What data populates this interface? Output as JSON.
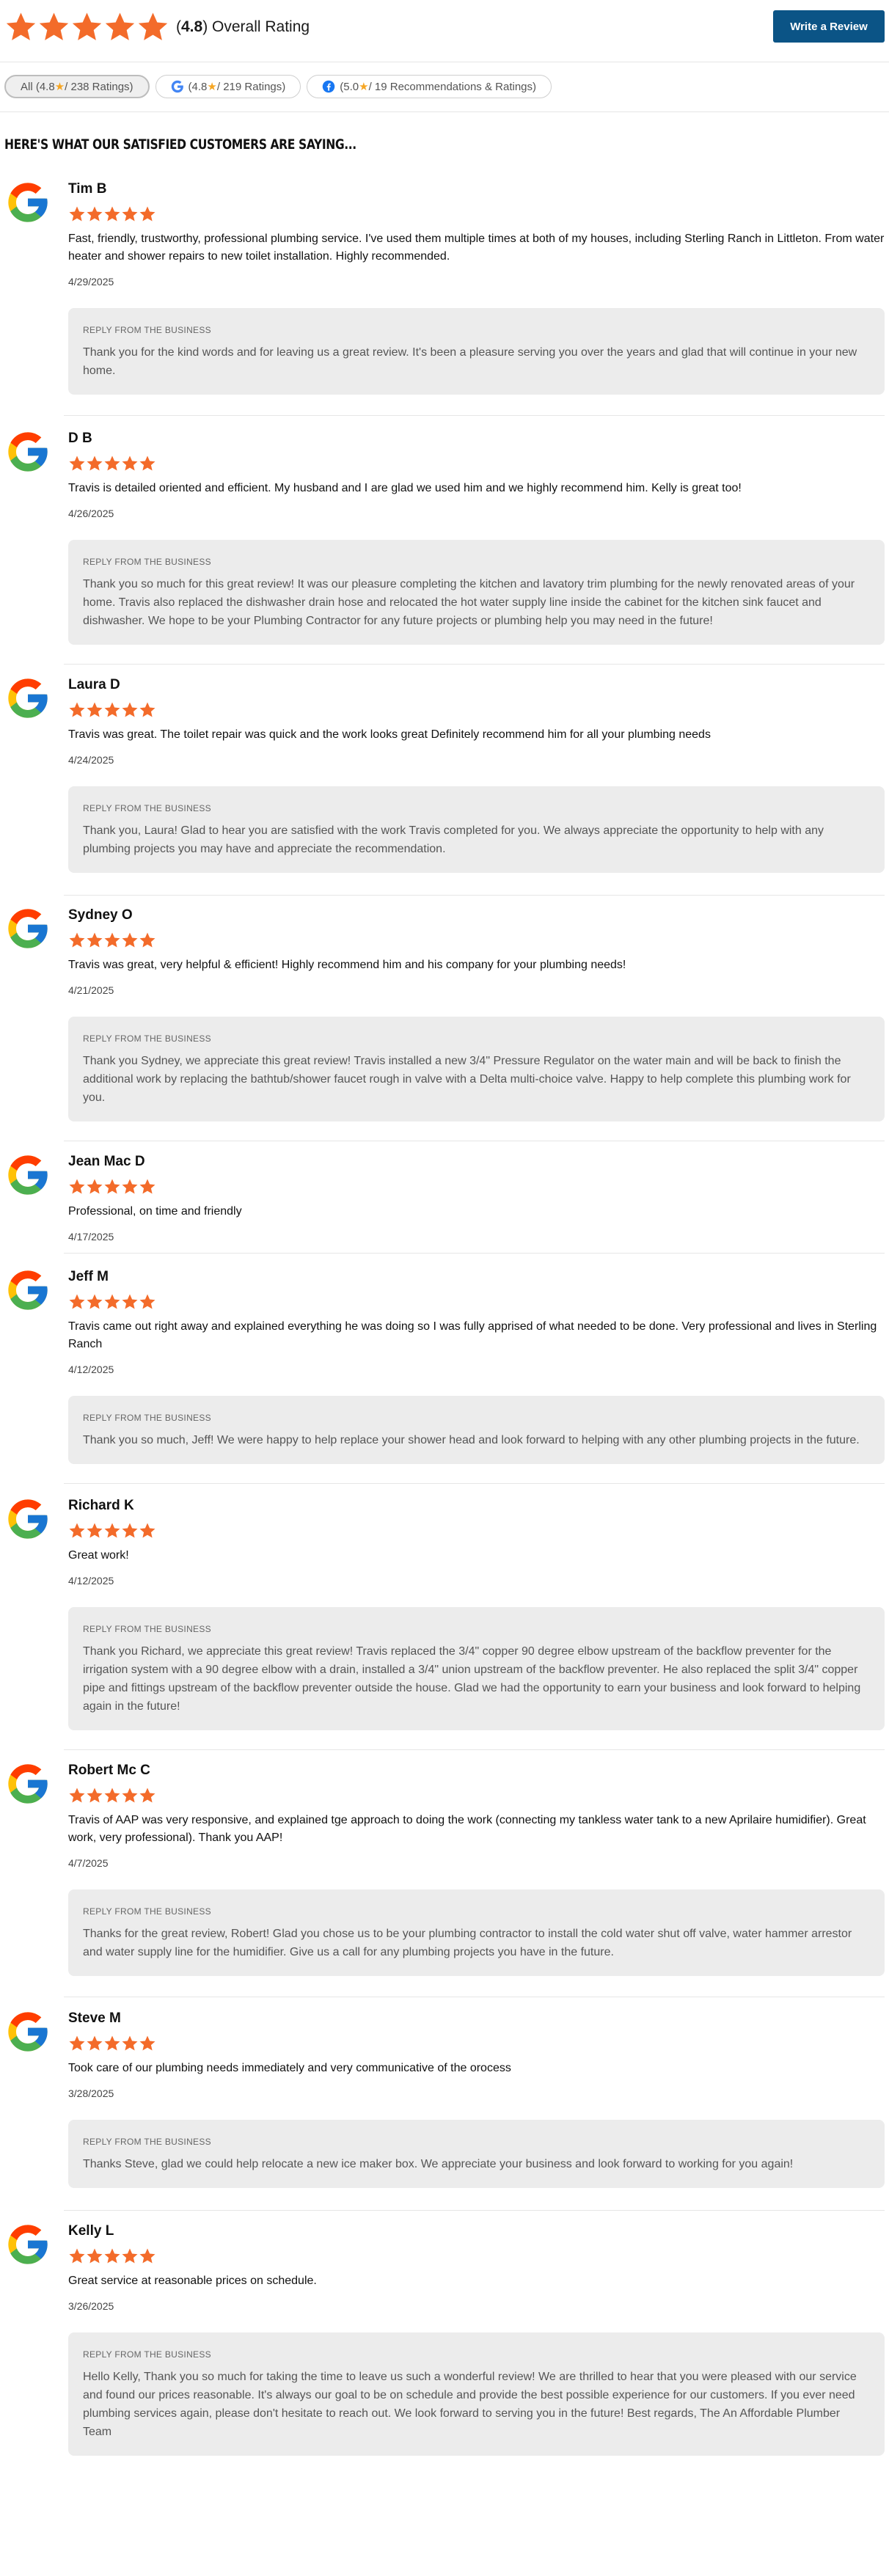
{
  "header": {
    "rating_value": "4.8",
    "rating_label": "Overall Rating",
    "write_button": "Write a Review"
  },
  "filters": [
    {
      "prefix": "All (",
      "value": "4.8",
      "suffix": " / 238 Ratings)"
    },
    {
      "prefix": "(",
      "value": "4.8",
      "suffix": " / 219 Ratings)"
    },
    {
      "prefix": "(",
      "value": "5.0",
      "suffix": " / 19 Recommendations & Ratings)"
    }
  ],
  "section_title": "HERE'S WHAT OUR SATISFIED CUSTOMERS ARE SAYING...",
  "colors": {
    "star": "#f36b2a",
    "button": "#0b5486",
    "reply_bg": "#ececec"
  },
  "reviews": [
    {
      "name": "Tim B",
      "stars": 5,
      "text": "Fast, friendly, trustworthy, professional plumbing service. I've used them multiple times at both of my houses, including Sterling Ranch in Littleton. From water heater and shower repairs to new toilet installation. Highly recommended.",
      "date": "4/29/2025",
      "reply_label": "REPLY FROM THE BUSINESS",
      "reply": "Thank you for the kind words and for leaving us a great review. It's been a pleasure serving you over the years and glad that will continue in your new home."
    },
    {
      "name": "D B",
      "stars": 5,
      "text": "Travis is detailed oriented and efficient. My husband and I are glad we used him and we highly recommend him. Kelly is great too!",
      "date": "4/26/2025",
      "reply_label": "REPLY FROM THE BUSINESS",
      "reply": "Thank you so much for this great review! It was our pleasure completing the kitchen and lavatory trim plumbing for the newly renovated areas of your home. Travis also replaced the dishwasher drain hose and relocated the hot water supply line inside the cabinet for the kitchen sink faucet and dishwasher. We hope to be your Plumbing Contractor for any future projects or plumbing help you may need in the future!"
    },
    {
      "name": "Laura D",
      "stars": 5,
      "text": "Travis was great. The toilet repair was quick and the work looks great Definitely recommend him for all your plumbing needs",
      "date": "4/24/2025",
      "reply_label": "REPLY FROM THE BUSINESS",
      "reply": "Thank you, Laura! Glad to hear you are satisfied with the work Travis completed for you. We always appreciate the opportunity to help with any plumbing projects you may have and appreciate the recommendation."
    },
    {
      "name": "Sydney O",
      "stars": 5,
      "text": "Travis was great, very helpful & efficient! Highly recommend him and his company for your plumbing needs!",
      "date": "4/21/2025",
      "reply_label": "REPLY FROM THE BUSINESS",
      "reply": "Thank you Sydney, we appreciate this great review! Travis installed a new 3/4\" Pressure Regulator on the water main and will be back to finish the additional work by replacing the bathtub/shower faucet rough in valve with a Delta multi-choice valve. Happy to help complete this plumbing work for you."
    },
    {
      "name": "Jean Mac D",
      "stars": 5,
      "text": "Professional, on time and friendly",
      "date": "4/17/2025",
      "reply_label": "",
      "reply": ""
    },
    {
      "name": "Jeff M",
      "stars": 5,
      "text": "Travis came out right away and explained everything he was doing so I was fully apprised of what needed to be done. Very professional and lives in Sterling Ranch",
      "date": "4/12/2025",
      "reply_label": "REPLY FROM THE BUSINESS",
      "reply": "Thank you so much, Jeff! We were happy to help replace your shower head and look forward to helping with any other plumbing projects in the future."
    },
    {
      "name": "Richard K",
      "stars": 5,
      "text": "Great work!",
      "date": "4/12/2025",
      "reply_label": "REPLY FROM THE BUSINESS",
      "reply": "Thank you Richard, we appreciate this great review! Travis replaced the 3/4\" copper 90 degree elbow upstream of the backflow preventer for the irrigation system with a 90 degree elbow with a drain, installed a 3/4\" union upstream of the backflow preventer. He also replaced the split 3/4\" copper pipe and fittings upstream of the backflow preventer outside the house. Glad we had the opportunity to earn your business and look forward to helping again in the future!"
    },
    {
      "name": "Robert Mc C",
      "stars": 5,
      "text": "Travis of AAP was very responsive, and explained tge approach to doing the work (connecting my tankless water tank to a new Aprilaire humidifier). Great work, very professional). Thank you AAP!",
      "date": "4/7/2025",
      "reply_label": "REPLY FROM THE BUSINESS",
      "reply": "Thanks for the great review, Robert! Glad you chose us to be your plumbing contractor to install the cold water shut off valve, water hammer arrestor and water supply line for the humidifier. Give us a call for any plumbing projects you have in the future."
    },
    {
      "name": "Steve M",
      "stars": 5,
      "text": "Took care of our plumbing needs immediately and very communicative of the orocess",
      "date": "3/28/2025",
      "reply_label": "REPLY FROM THE BUSINESS",
      "reply": "Thanks Steve, glad we could help relocate a new ice maker box. We appreciate your business and look forward to working for you again!"
    },
    {
      "name": "Kelly L",
      "stars": 5,
      "text": "Great service at reasonable prices on schedule.",
      "date": "3/26/2025",
      "reply_label": "REPLY FROM THE BUSINESS",
      "reply": "Hello Kelly, Thank you so much for taking the time to leave us such a wonderful review! We are thrilled to hear that you were pleased with our service and found our prices reasonable. It's always our goal to be on schedule and provide the best possible experience for our customers. If you ever need plumbing services again, please don't hesitate to reach out. We look forward to serving you in the future! Best regards, The An Affordable Plumber Team"
    }
  ]
}
